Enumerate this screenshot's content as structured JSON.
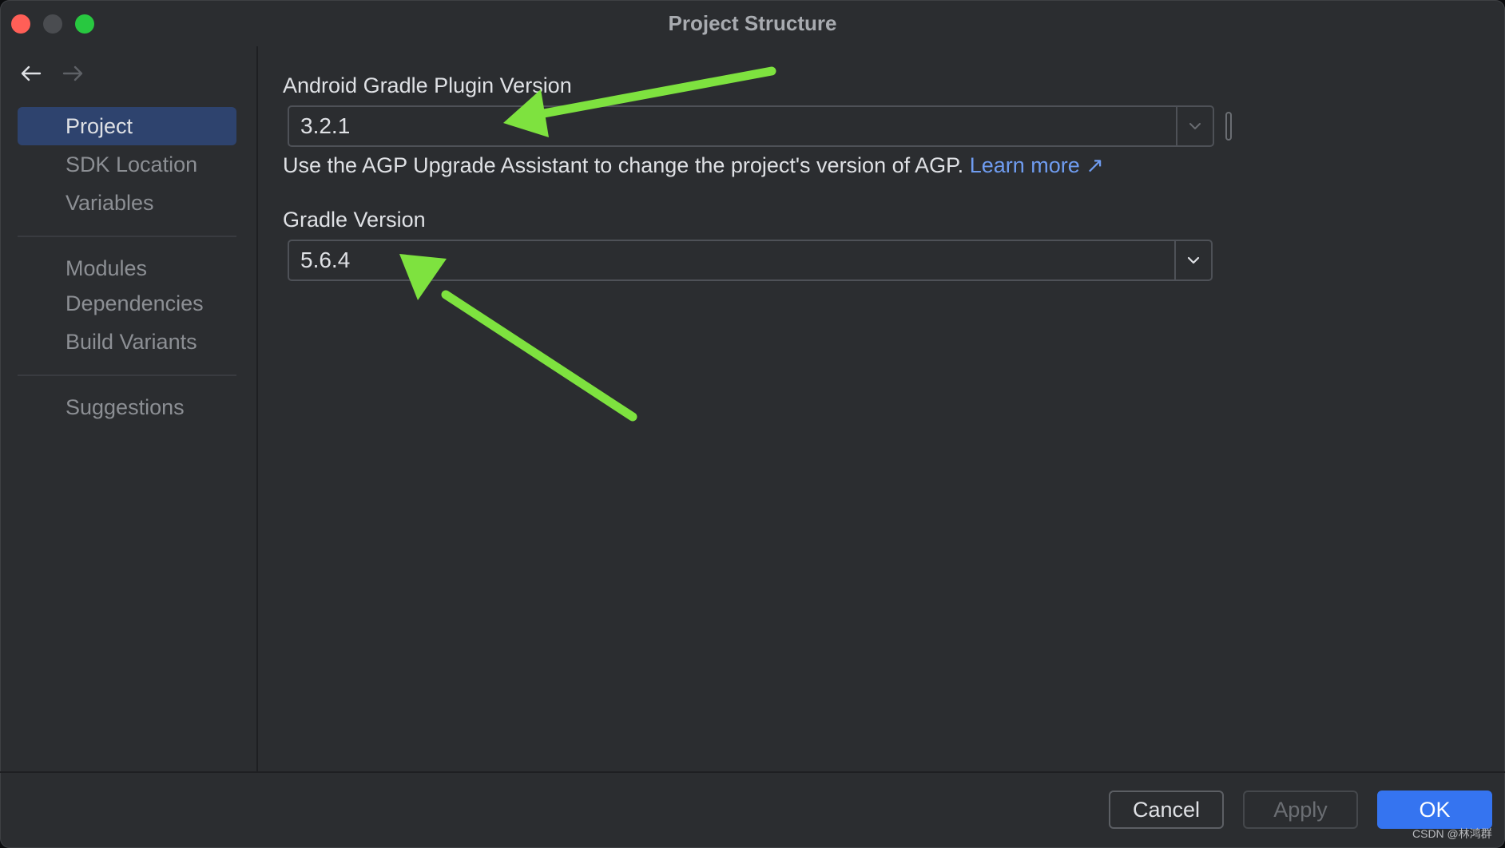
{
  "window": {
    "title": "Project Structure"
  },
  "sidebar": {
    "items": [
      {
        "label": "Project",
        "selected": true
      },
      {
        "label": "SDK Location"
      },
      {
        "label": "Variables"
      },
      {
        "label": "Modules"
      },
      {
        "label": "Dependencies"
      },
      {
        "label": "Build Variants"
      },
      {
        "label": "Suggestions"
      }
    ]
  },
  "main": {
    "agp": {
      "label": "Android Gradle Plugin Version",
      "value": "3.2.1",
      "hint": "Use the AGP Upgrade Assistant to change the project's version of AGP.",
      "link": "Learn more ↗"
    },
    "gradle": {
      "label": "Gradle Version",
      "value": "5.6.4"
    }
  },
  "footer": {
    "cancel": "Cancel",
    "apply": "Apply",
    "ok": "OK"
  },
  "watermark": "CSDN @林鸿群",
  "colors": {
    "accent": "#3574f0",
    "link": "#6f9cf0",
    "annotation": "#7ee23f",
    "selection": "#2e436e"
  }
}
